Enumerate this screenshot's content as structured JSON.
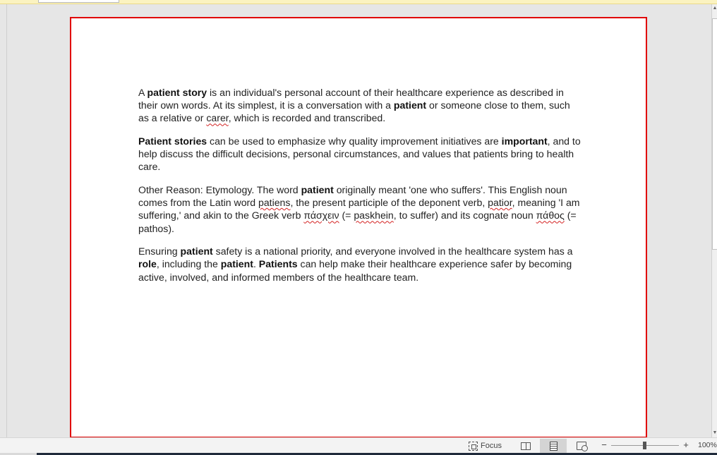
{
  "document": {
    "paragraphs": [
      {
        "runs": [
          {
            "text": "A "
          },
          {
            "text": "patient story",
            "bold": true
          },
          {
            "text": " is an individual's personal account of their healthcare experience as described in their own words. At its simplest, it is a conversation with a "
          },
          {
            "text": "patient",
            "bold": true
          },
          {
            "text": " or someone close to them, such as a relative or "
          },
          {
            "text": "carer",
            "spell": true
          },
          {
            "text": ", which is recorded and transcribed."
          }
        ]
      },
      {
        "runs": [
          {
            "text": "Patient stories",
            "bold": true
          },
          {
            "text": " can be used to emphasize why quality improvement initiatives are "
          },
          {
            "text": "important",
            "bold": true
          },
          {
            "text": ", and to help discuss the difficult decisions, personal circumstances, and values that patients bring to health care."
          }
        ]
      },
      {
        "runs": [
          {
            "text": "Other Reason: Etymology. The word "
          },
          {
            "text": "patient",
            "bold": true
          },
          {
            "text": " originally meant 'one who suffers'. This English noun comes from the Latin word "
          },
          {
            "text": "patiens",
            "spell": true
          },
          {
            "text": ", the present participle of the deponent verb, "
          },
          {
            "text": "patior",
            "spell": true
          },
          {
            "text": ", meaning 'I am suffering,' and akin to the Greek verb "
          },
          {
            "text": "πάσχειν",
            "spell": true
          },
          {
            "text": " (= "
          },
          {
            "text": "paskhein",
            "spell": true
          },
          {
            "text": ", to suffer) and its cognate noun "
          },
          {
            "text": "πάθος",
            "spell": true
          },
          {
            "text": " (= pathos)."
          }
        ]
      },
      {
        "runs": [
          {
            "text": "Ensuring "
          },
          {
            "text": "patient",
            "bold": true
          },
          {
            "text": " safety is a national priority, and everyone involved in the healthcare system has a "
          },
          {
            "text": "role",
            "bold": true
          },
          {
            "text": ", including the "
          },
          {
            "text": "patient",
            "bold": true
          },
          {
            "text": ". "
          },
          {
            "text": "Patients",
            "bold": true
          },
          {
            "text": " can help make their healthcare experience safer by becoming active, involved, and informed members of the healthcare team."
          }
        ]
      }
    ]
  },
  "statusbar": {
    "focus_label": "Focus",
    "zoom_minus": "−",
    "zoom_plus": "+",
    "zoom_level": "100%",
    "zoom_percent": 100,
    "active_view": "print-layout"
  },
  "scrollbar": {
    "up_arrow": "▲",
    "down_arrow": "▼"
  },
  "colors": {
    "page_border": "#e00000",
    "spellcheck_underline": "#d42020",
    "canvas_background": "#e6e6e6"
  },
  "icons": [
    "focus-icon",
    "read-mode-icon",
    "print-layout-icon",
    "web-layout-icon"
  ]
}
